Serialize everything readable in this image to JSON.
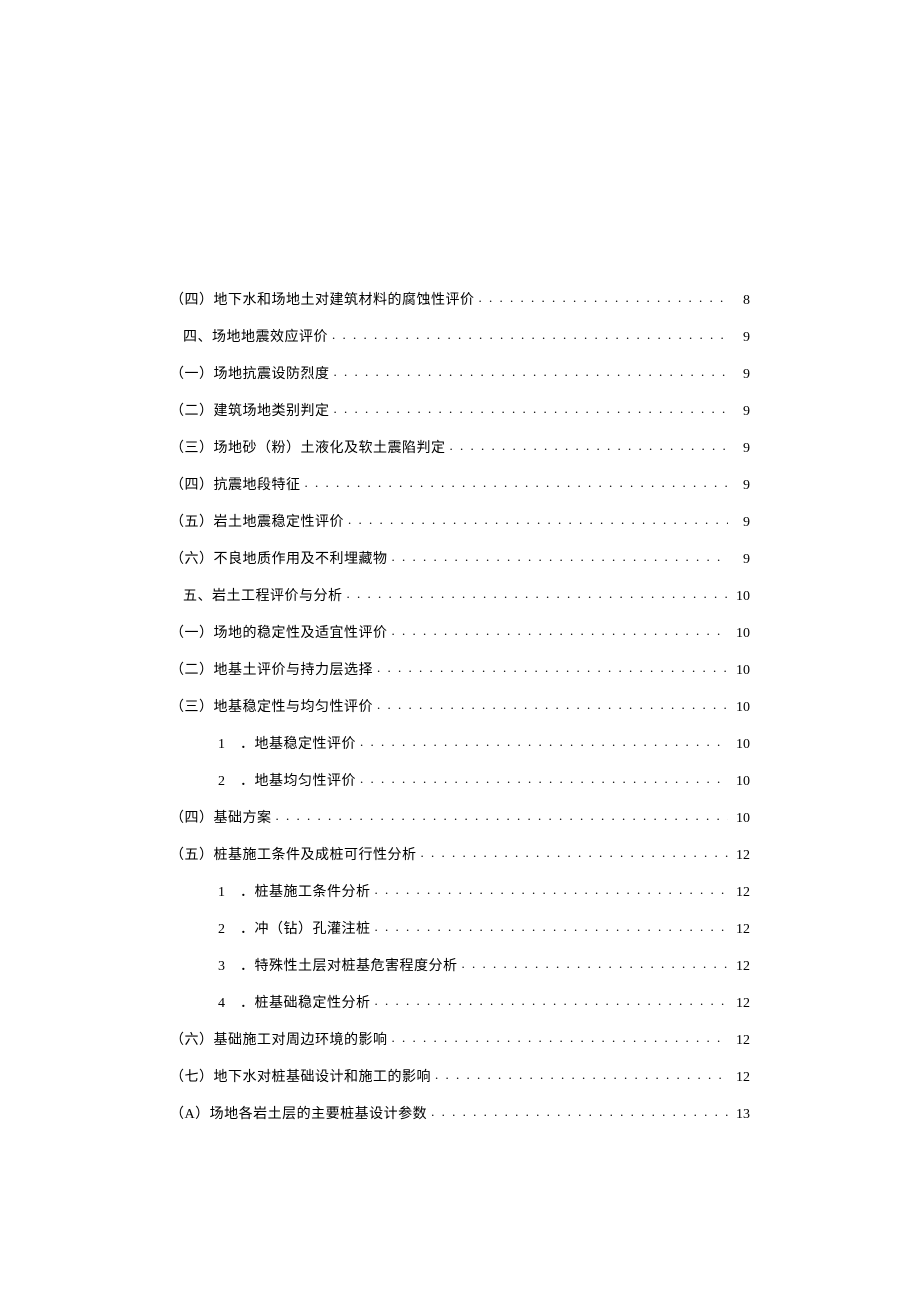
{
  "toc": [
    {
      "level": 1,
      "label": "（四）地下水和场地土对建筑材料的腐蚀性评价",
      "page": "8"
    },
    {
      "level": 0,
      "label": "四、场地地震效应评价",
      "page": "9"
    },
    {
      "level": 1,
      "label": "（一）场地抗震设防烈度",
      "page": "9"
    },
    {
      "level": 1,
      "label": "（二）建筑场地类别判定",
      "page": "9"
    },
    {
      "level": 1,
      "label": "（三）场地砂（粉）土液化及软土震陷判定",
      "page": "9"
    },
    {
      "level": 1,
      "label": "（四）抗震地段特征",
      "page": "9"
    },
    {
      "level": 1,
      "label": "（五）岩土地震稳定性评价",
      "page": "9"
    },
    {
      "level": 1,
      "label": "（六）不良地质作用及不利埋藏物",
      "page": "9"
    },
    {
      "level": 0,
      "label": "五、岩土工程评价与分析",
      "page": "10"
    },
    {
      "level": 1,
      "label": "（一）场地的稳定性及适宜性评价",
      "page": "10"
    },
    {
      "level": 1,
      "label": "（二）地基土评价与持力层选择",
      "page": "10"
    },
    {
      "level": 1,
      "label": "（三）地基稳定性与均匀性评价",
      "page": "10"
    },
    {
      "level": 2,
      "num": "1",
      "label": "．地基稳定性评价",
      "page": "10"
    },
    {
      "level": 2,
      "num": "2",
      "label": "．地基均匀性评价",
      "page": "10"
    },
    {
      "level": 1,
      "label": "（四）基础方案",
      "page": "10"
    },
    {
      "level": 1,
      "label": "（五）桩基施工条件及成桩可行性分析",
      "page": "12"
    },
    {
      "level": 2,
      "num": "1",
      "label": "．桩基施工条件分析",
      "page": "12"
    },
    {
      "level": 2,
      "num": "2",
      "label": "．冲（钻）孔灌注桩",
      "page": "12"
    },
    {
      "level": 2,
      "num": "3",
      "label": "．特殊性土层对桩基危害程度分析",
      "page": "12"
    },
    {
      "level": 2,
      "num": "4",
      "label": "．桩基础稳定性分析",
      "page": "12"
    },
    {
      "level": 1,
      "label": "（六）基础施工对周边环境的影响",
      "page": "12"
    },
    {
      "level": 1,
      "label": "（七）地下水对桩基础设计和施工的影响",
      "page": "12"
    },
    {
      "level": 1,
      "label": "（A）场地各岩土层的主要桩基设计参数",
      "page": "13"
    }
  ]
}
